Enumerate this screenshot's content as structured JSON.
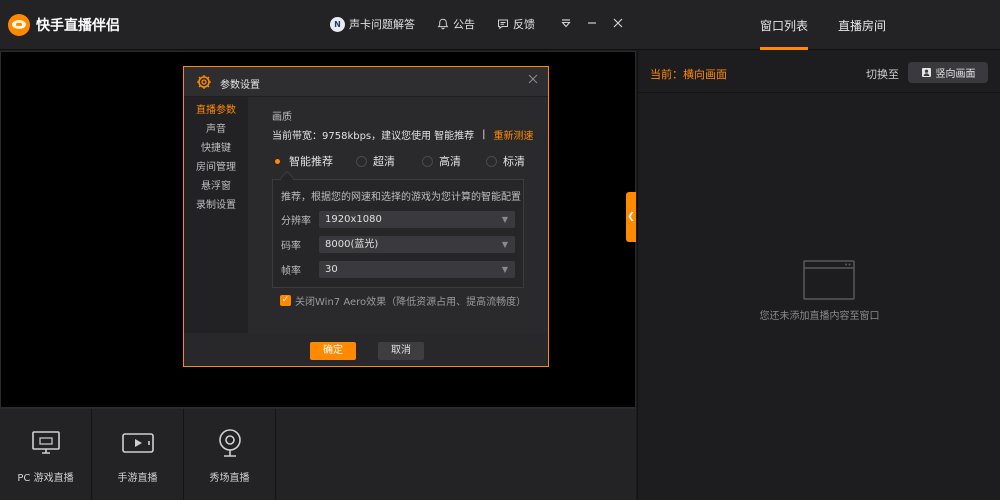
{
  "app": {
    "title": "快手直播伴侣"
  },
  "topbar": {
    "help_label": "声卡问题解答",
    "announce_label": "公告",
    "feedback_label": "反馈"
  },
  "right_tabs": [
    "窗口列表",
    "直播房间"
  ],
  "right_panel": {
    "current_label": "当前：横向画面",
    "switch_label": "切换至",
    "switch_button": "竖向画面",
    "empty_text": "您还未添加直播内容至窗口"
  },
  "bottom_modes": [
    {
      "label": "PC 游戏直播",
      "icon": "monitor-icon"
    },
    {
      "label": "手游直播",
      "icon": "phone-landscape-icon"
    },
    {
      "label": "秀场直播",
      "icon": "webcam-icon"
    }
  ],
  "dialog": {
    "title": "参数设置",
    "nav": [
      "直播参数",
      "声音",
      "快捷键",
      "房间管理",
      "悬浮窗",
      "录制设置"
    ],
    "active_nav": 0,
    "section_title": "画质",
    "bandwidth_text": "当前带宽：9758kbps，建议您使用",
    "bandwidth_recommend": "智能推荐",
    "bandwidth_sep": "|",
    "retest_label": "重新测速",
    "quality_options": [
      "智能推荐",
      "超清",
      "高清",
      "标清"
    ],
    "selected_quality": 0,
    "recommend_text": "推荐，根据您的网速和选择的游戏为您计算的智能配置",
    "fields": [
      {
        "label": "分辨率",
        "value": "1920x1080"
      },
      {
        "label": "码率",
        "value": "8000(蓝光)"
      },
      {
        "label": "帧率",
        "value": "30"
      }
    ],
    "aero_label": "关闭Win7 Aero效果（降低资源占用、提高流畅度）",
    "aero_checked": true,
    "ok_label": "确定",
    "cancel_label": "取消"
  },
  "colors": {
    "accent": "#ff8a00",
    "background": "#1c1c1e",
    "preview": "#000000"
  }
}
